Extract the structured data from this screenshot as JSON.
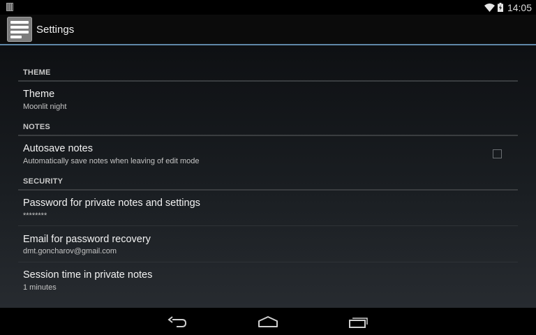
{
  "status_bar": {
    "time": "14:05",
    "icons": [
      "notification-icon",
      "wifi-icon",
      "battery-icon"
    ]
  },
  "action_bar": {
    "title": "Settings",
    "app_icon": "notes-app-icon",
    "divider_color": "#5f87a8"
  },
  "sections": {
    "theme": {
      "header": "THEME",
      "items": [
        {
          "title": "Theme",
          "summary": "Moonlit night"
        }
      ]
    },
    "notes": {
      "header": "NOTES",
      "items": [
        {
          "title": "Autosave notes",
          "summary": "Automatically save notes when leaving of edit mode",
          "checked": false
        }
      ]
    },
    "security": {
      "header": "SECURITY",
      "items": [
        {
          "title": "Password for private notes and settings",
          "summary": "********"
        },
        {
          "title": "Email for password recovery",
          "summary": "dmt.goncharov@gmail.com"
        },
        {
          "title": "Session time in private notes",
          "summary": "1 minutes"
        }
      ]
    }
  },
  "nav_bar": {
    "buttons": [
      "back-icon",
      "home-icon",
      "recent-apps-icon"
    ]
  }
}
